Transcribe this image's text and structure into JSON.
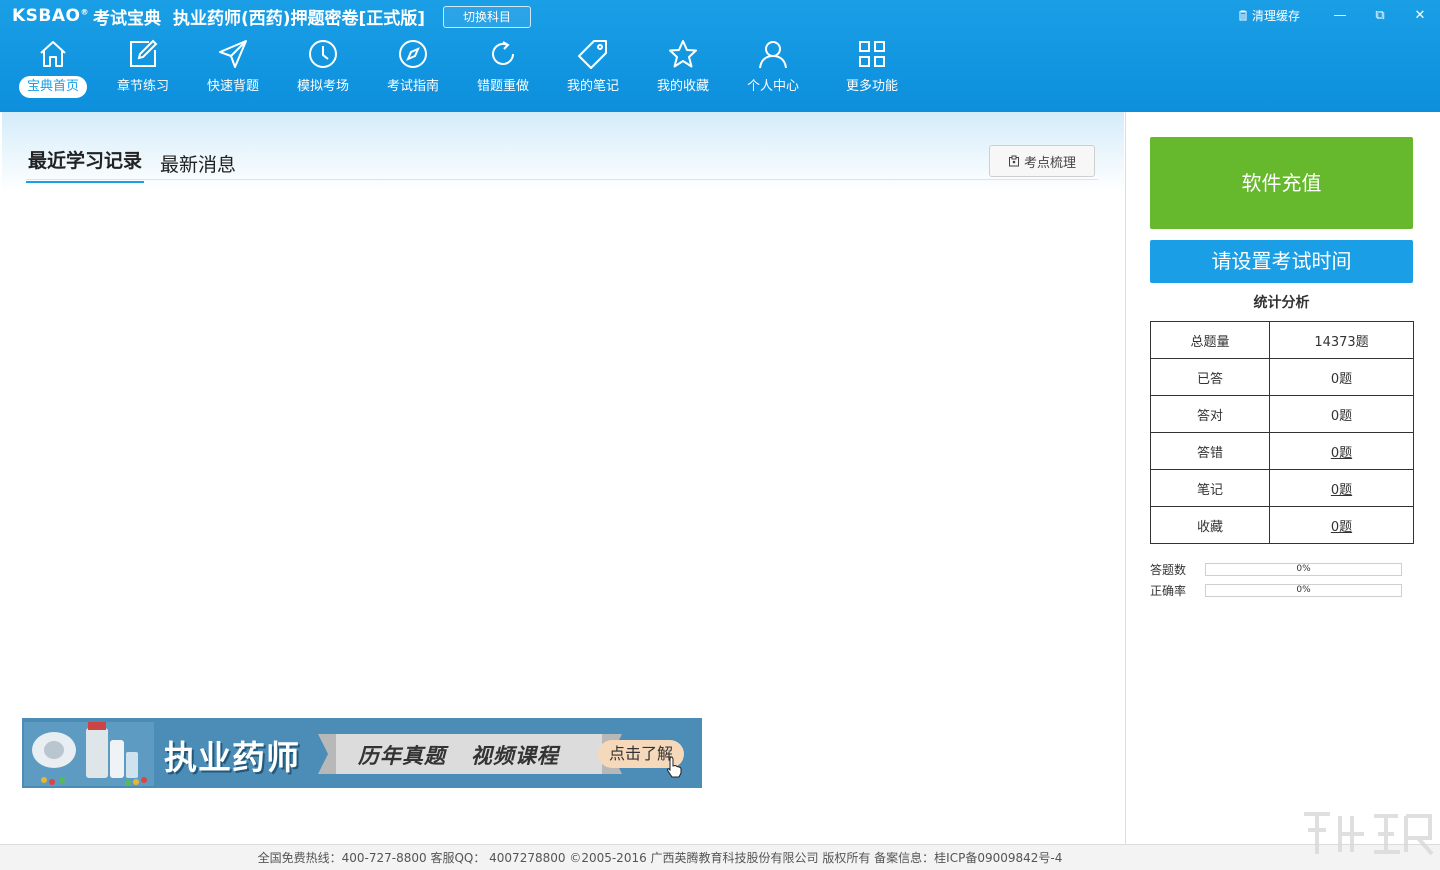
{
  "header": {
    "logo": "KSBAO",
    "logo_mark": "®",
    "brand_name": "考试宝典",
    "app_title": "执业药师(西药)押题密卷[正式版]",
    "switch_subject": "切换科目",
    "clear_cache": "清理缓存",
    "minimize": "—",
    "restore": "⧉",
    "close": "✕"
  },
  "nav": [
    {
      "label": "宝典首页",
      "icon": "home-icon",
      "active": true
    },
    {
      "label": "章节练习",
      "icon": "edit-icon"
    },
    {
      "label": "快速背题",
      "icon": "send-icon"
    },
    {
      "label": "模拟考场",
      "icon": "clock-icon"
    },
    {
      "label": "考试指南",
      "icon": "compass-icon"
    },
    {
      "label": "错题重做",
      "icon": "refresh-icon"
    },
    {
      "label": "我的笔记",
      "icon": "tag-icon"
    },
    {
      "label": "我的收藏",
      "icon": "star-icon"
    },
    {
      "label": "个人中心",
      "icon": "user-icon"
    },
    {
      "label": "更多功能",
      "icon": "grid-icon"
    }
  ],
  "main": {
    "tabs": [
      {
        "label": "最近学习记录",
        "active": true
      },
      {
        "label": "最新消息"
      }
    ],
    "kaodian_button": "考点梳理"
  },
  "banner": {
    "title": "执业药师",
    "subtitle": "历年真题   视频课程",
    "cta": "点击了解"
  },
  "sidebar": {
    "recharge_button": "软件充值",
    "exam_time_button": "请设置考试时间",
    "stats_title": "统计分析",
    "stats": [
      {
        "label": "总题量",
        "value": "14373题",
        "link": false
      },
      {
        "label": "已答",
        "value": "0题",
        "link": false
      },
      {
        "label": "答对",
        "value": "0题",
        "link": false
      },
      {
        "label": "答错",
        "value": "0题",
        "link": true
      },
      {
        "label": "笔记",
        "value": "0题",
        "link": true
      },
      {
        "label": "收藏",
        "value": "0题",
        "link": true
      }
    ],
    "progress": [
      {
        "label": "答题数",
        "value": "0%",
        "fraction": 0
      },
      {
        "label": "正确率",
        "value": "0%",
        "fraction": 0
      }
    ]
  },
  "footer": {
    "text": "全国免费热线：400-727-8800   客服QQ： 4007278800    ©2005-2016  广西英腾教育科技股份有限公司 版权所有  备案信息：桂ICP备09009842号-4"
  },
  "colors": {
    "header_blue": "#1a9fe6",
    "recharge_green": "#66b82c",
    "banner_blue": "#4b8db6"
  }
}
